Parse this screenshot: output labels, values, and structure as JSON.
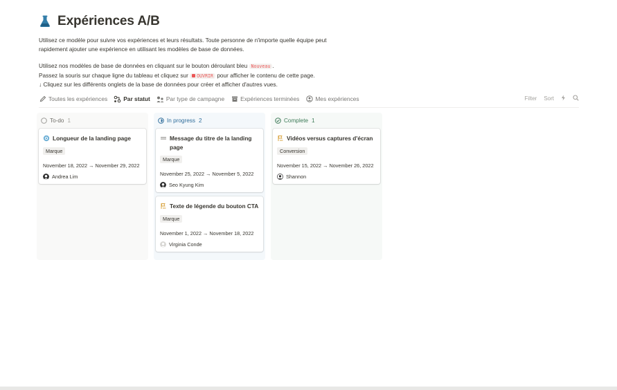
{
  "page": {
    "title": "Expériences A/B",
    "icon": "flask-icon",
    "description": [
      "Utilisez ce modèle pour suivre vos expériences et leurs résultats. Toute personne de n'importe quelle équipe peut",
      "rapidement ajouter une expérience en utilisant les modèles de base de données."
    ],
    "instructions": {
      "line1_before": "Utilisez nos modèles de base de données en cliquant sur le bouton déroulant bleu",
      "line1_code": "Nouveau",
      "line1_after": ".",
      "line2_before": "Passez la souris sur chaque ligne du tableau et cliquez sur",
      "line2_code": "OUVRIR",
      "line2_after": "pour afficher le contenu de cette page.",
      "line3": "↓ Cliquez sur les différents onglets de la base de données pour créer et afficher d'autres vues."
    }
  },
  "tabs": [
    {
      "label": "Toutes les expériences",
      "icon": "pencil-icon",
      "active": false
    },
    {
      "label": "Par statut",
      "icon": "status-icon",
      "active": true
    },
    {
      "label": "Par type de campagne",
      "icon": "megaphone-icon",
      "active": false
    },
    {
      "label": "Expériences terminées",
      "icon": "archive-icon",
      "active": false
    },
    {
      "label": "Mes expériences",
      "icon": "user-circle-icon",
      "active": false
    }
  ],
  "tools": {
    "filter": "Filter",
    "sort": "Sort"
  },
  "board": {
    "columns": [
      {
        "label": "To-do",
        "count": "1",
        "cards": [
          {
            "title": "Longueur de la landing page",
            "tag": "Marque",
            "dates": "November 18, 2022 → November 29, 2022",
            "person": "Andrea Lim"
          }
        ]
      },
      {
        "label": "In progress",
        "count": "2",
        "cards": [
          {
            "title": "Message du titre de la landing page",
            "tag": "Marque",
            "dates": "November 25, 2022 → November 5, 2022",
            "person": "Seo Kyung Kim"
          },
          {
            "title": "Texte de légende du bouton CTA",
            "tag": "Marque",
            "dates": "November 1, 2022 → November 18, 2022",
            "person": "Virginia Conde"
          }
        ]
      },
      {
        "label": "Complete",
        "count": "1",
        "cards": [
          {
            "title": "Vidéos versus captures d'écran",
            "tag": "Conversion",
            "dates": "November 15, 2022 → November 26, 2022",
            "person": "Shannon"
          }
        ]
      }
    ]
  },
  "colors": {
    "in_progress": "#2f6d9b",
    "complete": "#3c7a57",
    "code_text": "#eb5757"
  }
}
